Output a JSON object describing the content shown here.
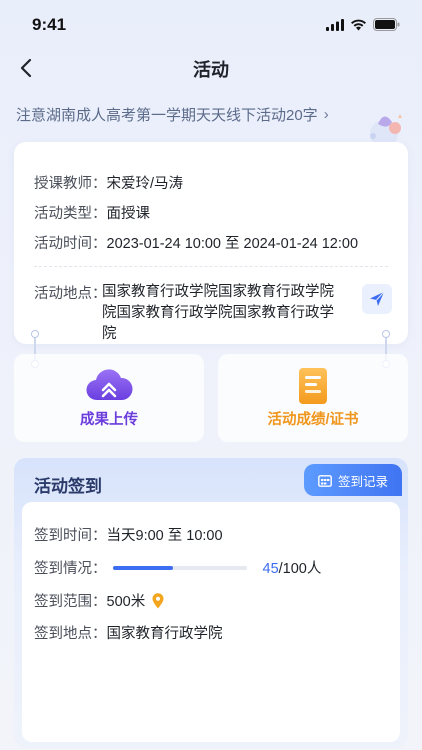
{
  "status": {
    "time": "9:41"
  },
  "nav": {
    "title": "活动"
  },
  "notice": {
    "text": "注意湖南成人高考第一学期天天线下活动20字"
  },
  "info": {
    "teacher_label": "授课教师：",
    "teacher": "宋爱玲/马涛",
    "type_label": "活动类型：",
    "type": "面授课",
    "time_label": "活动时间：",
    "time": "2023-01-24 10:00 至 2024-01-24 12:00",
    "address_label": "活动地点：",
    "address": "国家教育行政学院国家教育行政学院院国家教育行政学院国家教育行政学院"
  },
  "actions": [
    {
      "label": "成果上传",
      "color": "#6b3ddc"
    },
    {
      "label": "活动成绩/证书",
      "color": "#f0961c"
    }
  ],
  "checkin": {
    "title": "活动签到",
    "record_label": "签到记录",
    "time_label": "签到时间：",
    "time": "当天9:00 至 10:00",
    "status_label": "签到情况：",
    "checked": "45",
    "total_text": "/100人",
    "progress": 0.45,
    "range_label": "签到范围：",
    "range": "500米",
    "place_label": "签到地点：",
    "place": "国家教育行政学院"
  }
}
